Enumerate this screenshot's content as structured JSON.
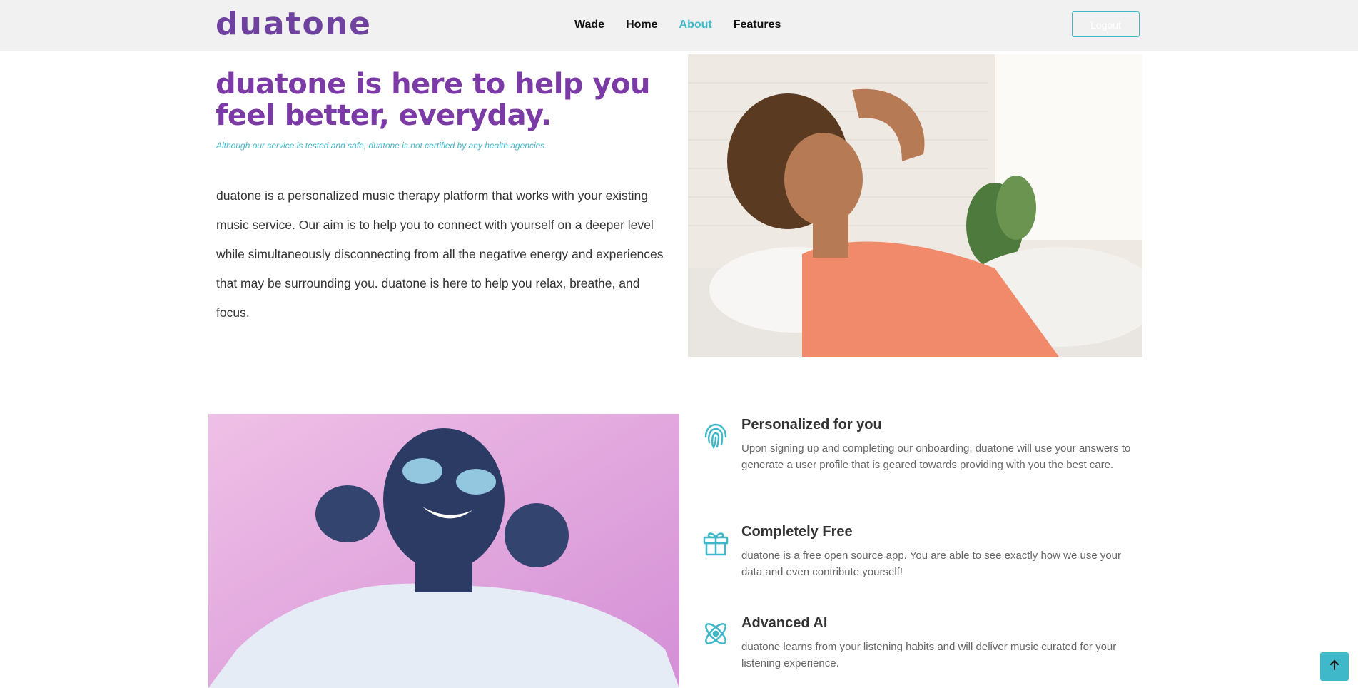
{
  "brand": {
    "logo": "duatone",
    "color": "#6f42a0",
    "accent": "#3fb8c9"
  },
  "nav": {
    "items": [
      {
        "label": "Wade",
        "active": false
      },
      {
        "label": "Home",
        "active": false
      },
      {
        "label": "About",
        "active": true
      },
      {
        "label": "Features",
        "active": false
      }
    ],
    "logout_label": "Logout"
  },
  "hero": {
    "title": "duatone is here to help you feel better, everyday.",
    "note": "Although our service is tested and safe, duatone is not certified by any health agencies.",
    "body": "duatone is a personalized music therapy platform that works with your existing music service. Our aim is to help you to connect with yourself on a deeper level while simultaneously disconnecting from all the negative energy and experiences that may be surrounding you. duatone is here to help you relax, breathe, and focus."
  },
  "features": [
    {
      "icon": "fingerprint-icon",
      "title": "Personalized for you",
      "desc": "Upon signing up and completing our onboarding, duatone will use your answers to generate a user profile that is geared towards providing with you the best care."
    },
    {
      "icon": "gift-icon",
      "title": "Completely Free",
      "desc": "duatone is a free open source app. You are able to see exactly how we use your data and even contribute yourself!"
    },
    {
      "icon": "atom-icon",
      "title": "Advanced AI",
      "desc": "duatone learns from your listening habits and will deliver music curated for your listening experience."
    }
  ],
  "back_to_top_icon": "arrow-up-icon"
}
